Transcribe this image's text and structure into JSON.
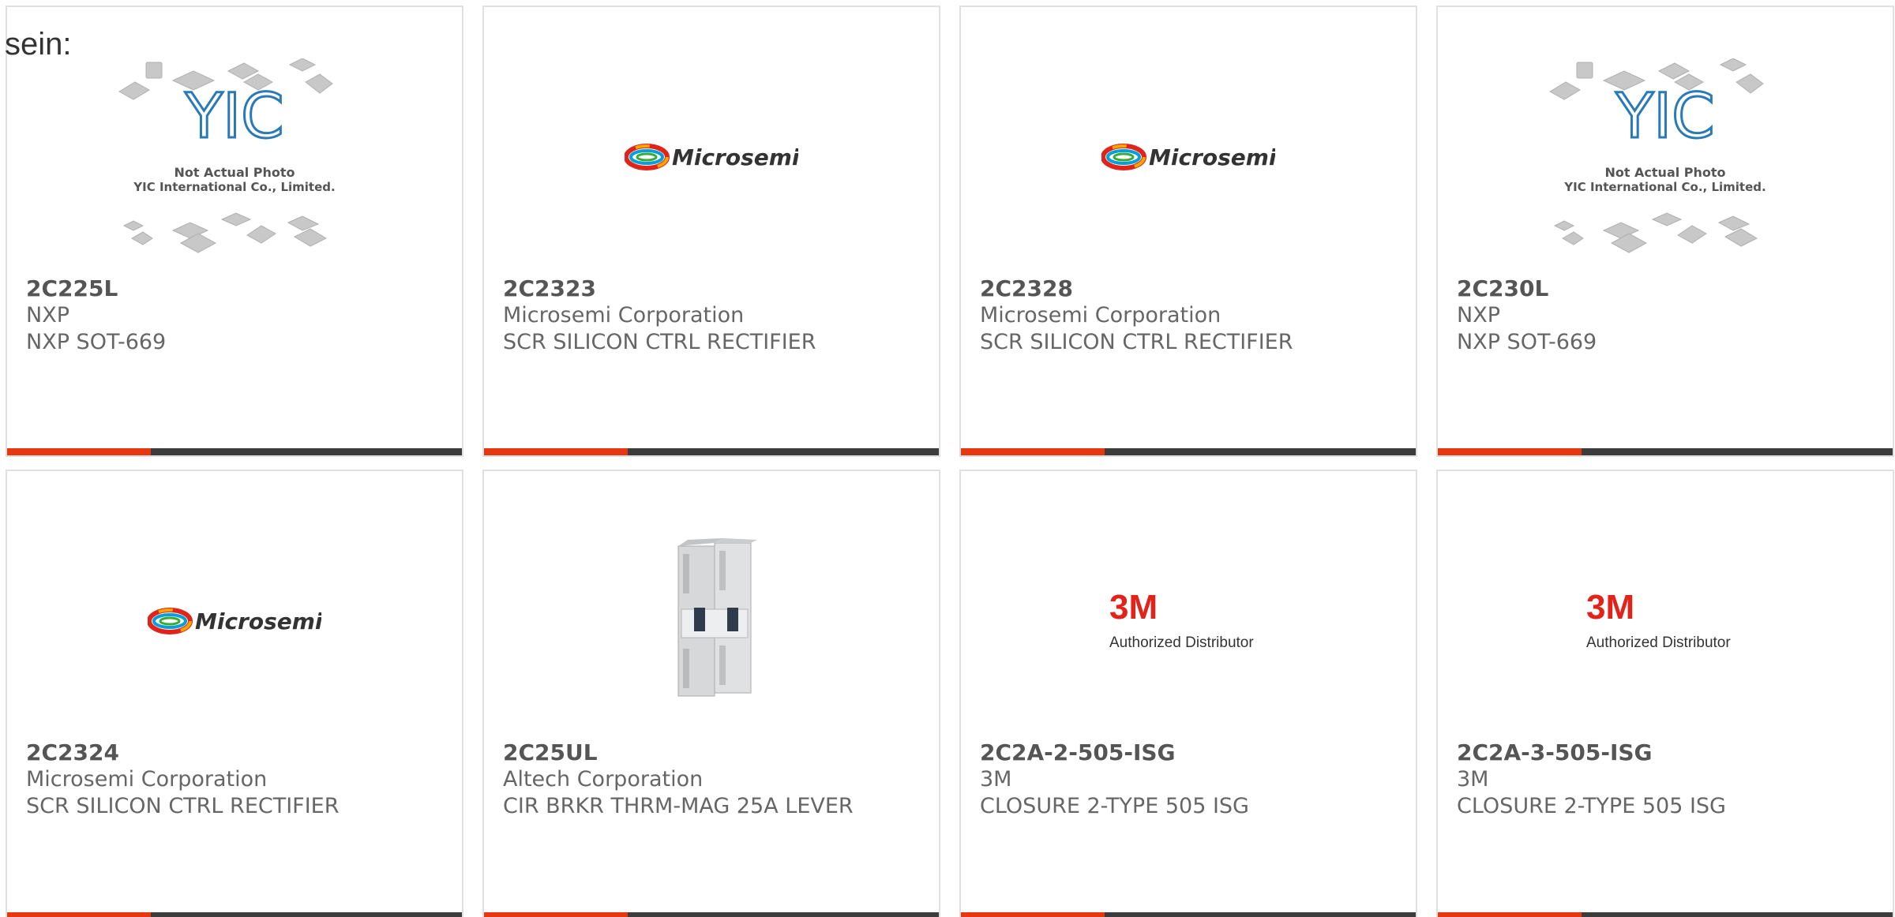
{
  "lead_text": "sein:",
  "colors": {
    "accent": "#e8360f",
    "bar_dark": "#3c3c3c",
    "text": "#666666"
  },
  "products": [
    {
      "part_number": "2C225L",
      "manufacturer": "NXP",
      "description": "NXP SOT-669",
      "image": {
        "type": "placeholder",
        "caption_1": "Not Actual Photo",
        "caption_2": "YIC International Co., Limited.",
        "logo": "YIC"
      }
    },
    {
      "part_number": "2C2323",
      "manufacturer": "Microsemi Corporation",
      "description": "SCR SILICON CTRL RECTIFIER",
      "image": {
        "type": "microsemi-logo",
        "logo": "Microsemi"
      }
    },
    {
      "part_number": "2C2328",
      "manufacturer": "Microsemi Corporation",
      "description": "SCR SILICON CTRL RECTIFIER",
      "image": {
        "type": "microsemi-logo",
        "logo": "Microsemi"
      }
    },
    {
      "part_number": "2C230L",
      "manufacturer": "NXP",
      "description": "NXP SOT-669",
      "image": {
        "type": "placeholder",
        "caption_1": "Not Actual Photo",
        "caption_2": "YIC International Co., Limited.",
        "logo": "YIC"
      }
    },
    {
      "part_number": "2C2324",
      "manufacturer": "Microsemi Corporation",
      "description": "SCR SILICON CTRL RECTIFIER",
      "image": {
        "type": "microsemi-logo",
        "logo": "Microsemi"
      }
    },
    {
      "part_number": "2C25UL",
      "manufacturer": "Altech Corporation",
      "description": "CIR BRKR THRM-MAG 25A LEVER",
      "image": {
        "type": "circuit-breaker-photo"
      }
    },
    {
      "part_number": "2C2A-2-505-ISG",
      "manufacturer": "3M",
      "description": "CLOSURE 2-TYPE 505 ISG",
      "image": {
        "type": "3m-logo",
        "logo": "3M",
        "caption": "Authorized Distributor"
      }
    },
    {
      "part_number": "2C2A-3-505-ISG",
      "manufacturer": "3M",
      "description": "CLOSURE 2-TYPE 505 ISG",
      "image": {
        "type": "3m-logo",
        "logo": "3M",
        "caption": "Authorized Distributor"
      }
    }
  ]
}
